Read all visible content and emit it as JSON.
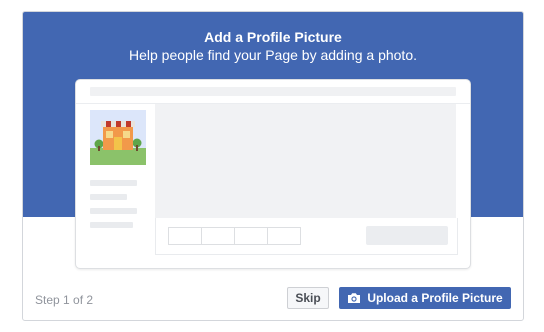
{
  "dialog": {
    "title": "Add a Profile Picture",
    "subtitle": "Help people find your Page by adding a photo.",
    "step_text": "Step 1 of 2",
    "skip_label": "Skip",
    "upload_label": "Upload a Profile Picture",
    "upload_icon": "camera-icon"
  },
  "colors": {
    "hero_blue": "#4267b2",
    "button_blue": "#4267b2",
    "text_gray": "#90949c"
  }
}
